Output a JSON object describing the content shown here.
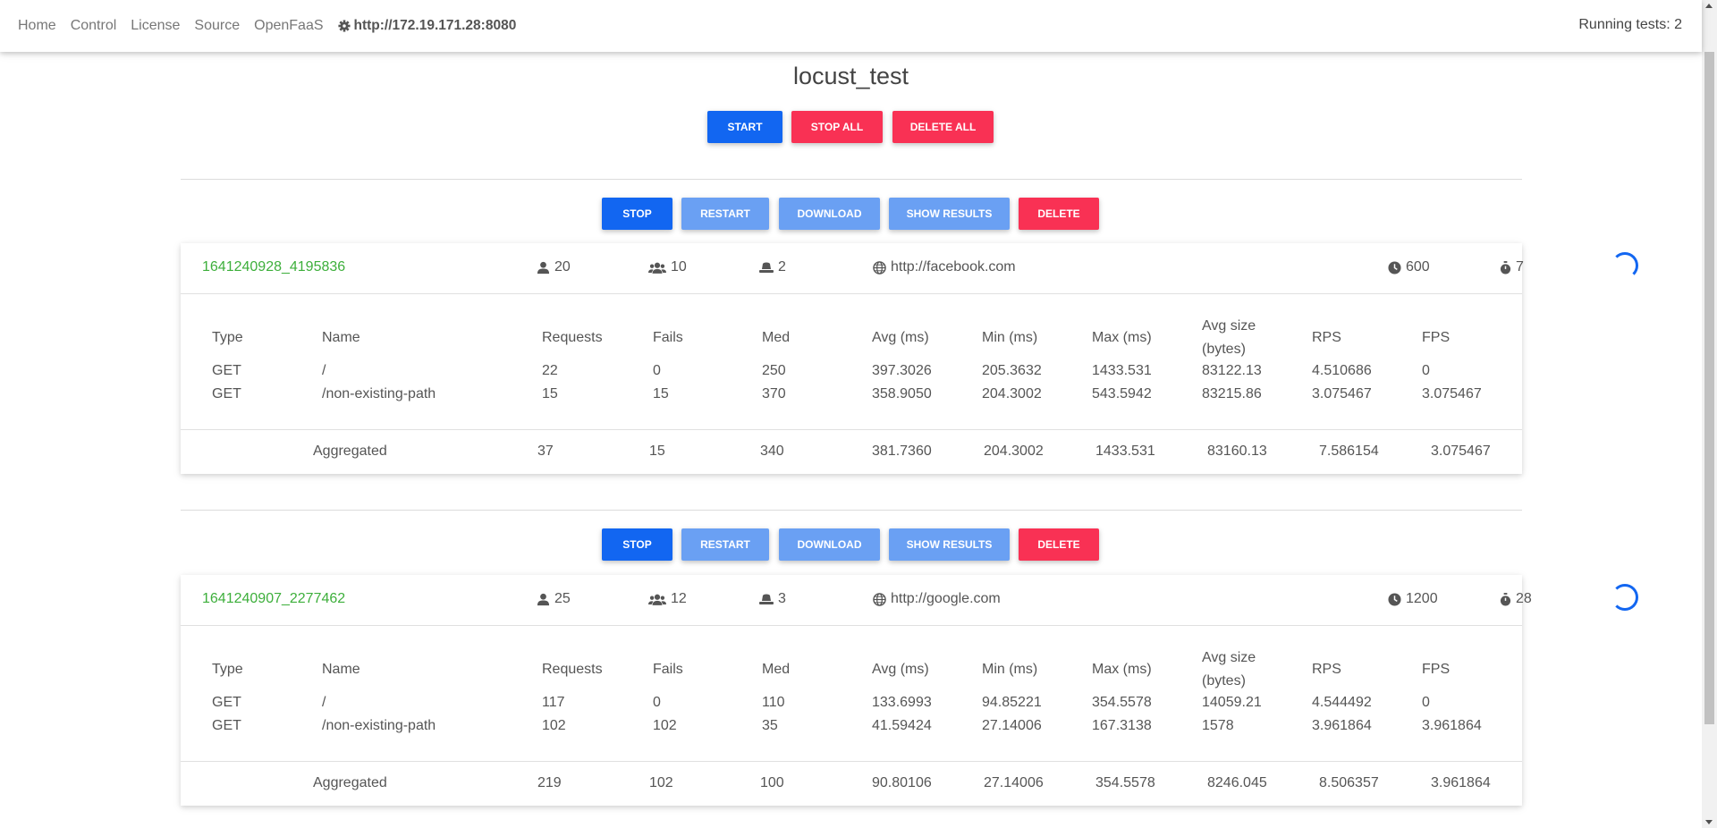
{
  "nav": {
    "links": [
      "Home",
      "Control",
      "License",
      "Source",
      "OpenFaaS"
    ],
    "host": "http://172.19.171.28:8080",
    "running": "Running tests: 2"
  },
  "page": {
    "title": "locust_test",
    "buttons": {
      "start": "START",
      "stop_all": "STOP ALL",
      "delete_all": "DELETE ALL"
    }
  },
  "test_buttons": {
    "stop": "STOP",
    "restart": "RESTART",
    "download": "DOWNLOAD",
    "show_results": "SHOW RESULTS",
    "delete": "DELETE"
  },
  "columns": {
    "type": "Type",
    "name": "Name",
    "requests": "Requests",
    "fails": "Fails",
    "med": "Med",
    "avg": "Avg (ms)",
    "min": "Min (ms)",
    "max": "Max (ms)",
    "avg_size_1": "Avg size",
    "avg_size_2": "(bytes)",
    "rps": "RPS",
    "fps": "FPS"
  },
  "tests": [
    {
      "id": "1641240928_4195836",
      "users": "20",
      "spawn_rate": "10",
      "workers": "2",
      "host": "http://facebook.com",
      "time": "600",
      "elapsed": "7",
      "rows": [
        {
          "type": "GET",
          "name": "/",
          "requests": "22",
          "fails": "0",
          "med": "250",
          "avg": "397.3026",
          "min": "205.3632",
          "max": "1433.531",
          "size": "83122.13",
          "rps": "4.510686",
          "fps": "0"
        },
        {
          "type": "GET",
          "name": "/non-existing-path",
          "requests": "15",
          "fails": "15",
          "med": "370",
          "avg": "358.9050",
          "min": "204.3002",
          "max": "543.5942",
          "size": "83215.86",
          "rps": "3.075467",
          "fps": "3.075467"
        }
      ],
      "aggregated": {
        "label": "Aggregated",
        "requests": "37",
        "fails": "15",
        "med": "340",
        "avg": "381.7360",
        "min": "204.3002",
        "max": "1433.531",
        "size": "83160.13",
        "rps": "7.586154",
        "fps": "3.075467"
      }
    },
    {
      "id": "1641240907_2277462",
      "users": "25",
      "spawn_rate": "12",
      "workers": "3",
      "host": "http://google.com",
      "time": "1200",
      "elapsed": "28",
      "rows": [
        {
          "type": "GET",
          "name": "/",
          "requests": "117",
          "fails": "0",
          "med": "110",
          "avg": "133.6993",
          "min": "94.85221",
          "max": "354.5578",
          "size": "14059.21",
          "rps": "4.544492",
          "fps": "0"
        },
        {
          "type": "GET",
          "name": "/non-existing-path",
          "requests": "102",
          "fails": "102",
          "med": "35",
          "avg": "41.59424",
          "min": "27.14006",
          "max": "167.3138",
          "size": "1578",
          "rps": "3.961864",
          "fps": "3.961864"
        }
      ],
      "aggregated": {
        "label": "Aggregated",
        "requests": "219",
        "fails": "102",
        "med": "100",
        "avg": "90.80106",
        "min": "27.14006",
        "max": "354.5578",
        "size": "8246.045",
        "rps": "8.506357",
        "fps": "3.961864"
      }
    }
  ],
  "colors": {
    "primary": "#1266f1",
    "danger": "#f93154",
    "primary_light": "#6aa0f3",
    "success_text": "#3daf3b"
  },
  "icons": {
    "host": "gear-icon",
    "users": "user-icon",
    "spawn_rate": "users-icon",
    "workers": "hat-icon",
    "url": "globe-icon",
    "time": "clock-icon",
    "elapsed": "stopwatch-icon",
    "status": "spinner-icon"
  }
}
